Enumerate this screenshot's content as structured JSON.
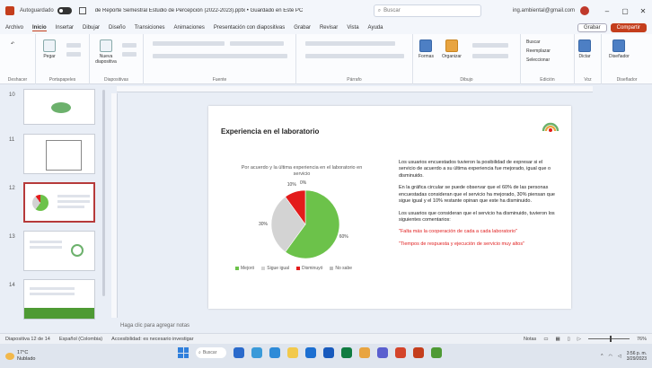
{
  "titlebar": {
    "autosave_label": "Autoguardado",
    "document_title": "de Reporte Semestral Estudio de Percepción (2022-2023).pptx • Guardado en Este PC",
    "search_placeholder": "Buscar",
    "user_email": "ing.ambiental@gmail.com"
  },
  "ribbon": {
    "tabs": [
      "Archivo",
      "Inicio",
      "Insertar",
      "Dibujar",
      "Diseño",
      "Transiciones",
      "Animaciones",
      "Presentación con diapositivas",
      "Grabar",
      "Revisar",
      "Vista",
      "Ayuda"
    ],
    "active_tab_index": 1,
    "grabar_btn": "Grabar",
    "compartir_btn": "Compartir",
    "groups": {
      "undo": "Deshacer",
      "clipboard": "Portapapeles",
      "slides": "Diapositivas",
      "font": "Fuente",
      "paragraph": "Párrafo",
      "drawing": "Dibujo",
      "editing": "Edición",
      "voice": "Voz",
      "designer": "Diseñador"
    },
    "buttons": {
      "paste": "Pegar",
      "new_slide": "Nueva diapositiva",
      "shapes": "Formas",
      "arrange": "Organizar",
      "find": "Buscar",
      "replace": "Reemplazar",
      "select": "Seleccionar",
      "dictate": "Dictar",
      "designer": "Diseñador"
    }
  },
  "thumbnails": [
    {
      "num": "10"
    },
    {
      "num": "11"
    },
    {
      "num": "12"
    },
    {
      "num": "13"
    },
    {
      "num": "14"
    }
  ],
  "slide": {
    "title": "Experiencia en el laboratorio",
    "chart_title": "Por acuerdo y la última experiencia en el laboratorio en servicio",
    "paragraphs": [
      "Los usuarios encuestados tuvieron la posibilidad de expresar si el servicio de acuerdo a su última experiencia fue mejorado, igual que o disminuido.",
      "En la gráfica circular se puede observar que el 60% de las personas encuestadas consideran que el servicio ha mejorado, 30% piensan que sigue igual y el 10% restante opinan que este ha disminuido.",
      "Los usuarios que consideran que el servicio ha disminuido, tuvieron los siguientes comentarios:"
    ],
    "quotes": [
      "\"Falta más la cooperación de cada a cada laboratorio\"",
      "\"Tiempos de respuesta y ejecución de servicio muy altos\""
    ]
  },
  "chart_data": {
    "type": "pie",
    "title": "Por acuerdo y la última experiencia en el laboratorio en servicio",
    "categories": [
      "Mejoró",
      "Sigue igual",
      "Disminuyó",
      "No sabe"
    ],
    "values": [
      60,
      30,
      10,
      0
    ],
    "labels": [
      "60%",
      "30%",
      "10%",
      "0%"
    ],
    "colors": [
      "#6cc24a",
      "#d3d3d3",
      "#e31b1b",
      "#bfbfbf"
    ],
    "legend_position": "bottom"
  },
  "notes_placeholder": "Haga clic para agregar notas",
  "statusbar": {
    "slide_info": "Diapositiva 12 de 14",
    "language": "Español (Colombia)",
    "accessibility": "Accesibilidad: es necesario investigar",
    "notes": "Notas",
    "zoom": "76%"
  },
  "taskbar": {
    "temp": "17°C",
    "weather": "Nublado",
    "search": "Buscar",
    "time": "3:56 p. m.",
    "date": "3/29/2023"
  }
}
